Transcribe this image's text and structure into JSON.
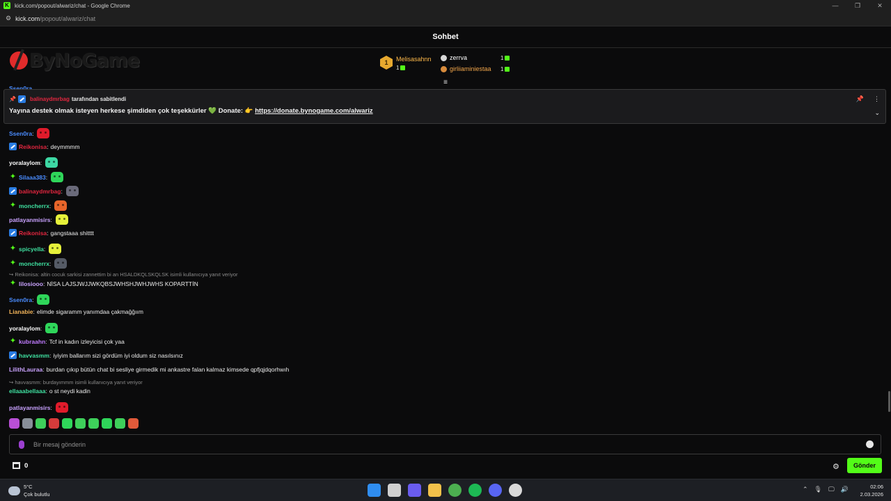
{
  "window": {
    "title": "kick.com/popout/alwariz/chat - Google Chrome",
    "controls": [
      "—",
      "❐",
      "✕"
    ],
    "url_host": "kick.com",
    "url_path": "/popout/alwariz/chat"
  },
  "chat": {
    "title": "Sohbet"
  },
  "logo": {
    "text": "ByNoGame"
  },
  "leaderboard": {
    "first": {
      "rank": "1",
      "name": "Melisasahnn",
      "count": "1"
    },
    "others": [
      {
        "name": "zerrva",
        "count": "1",
        "name_color": "#ffffff",
        "icon_color": "#d8d8d8"
      },
      {
        "name": "girliiaminiestaa",
        "count": "1",
        "name_color": "#f2a64a",
        "icon_color": "#d78b3c"
      }
    ]
  },
  "pinned": {
    "pinned_by_user": "balinaydmrbag",
    "pinned_by_label": "tarafından sabitlendi",
    "text_before": "Yayına destek olmak isteyen herkese şimdiden çok teşekkürler ",
    "heart": "💚",
    "text_mid": " Donate: ",
    "hand": "👉",
    "link": "https://donate.bynogame.com/alwariz"
  },
  "messages": [
    {
      "user": "Ssen0ra",
      "color": "#4a8cff",
      "badge": "none",
      "text": "",
      "emote": "#e01b2b"
    },
    {
      "user": "Reikonisa",
      "color": "#e3263f",
      "badge": "sub",
      "text": "deymmmm",
      "emote": ""
    },
    {
      "user": "yoralaylom",
      "color": "#ffffff",
      "badge": "none",
      "text": "",
      "emote": "#3dd8a4"
    },
    {
      "user": "Silaaa383",
      "color": "#4a8cff",
      "badge": "star",
      "text": "",
      "emote": "#2fd65a"
    },
    {
      "user": "balinaydmrbag",
      "color": "#e3263f",
      "badge": "sub",
      "text": "",
      "emote": "#6a6a7a"
    },
    {
      "user": "moncherrx",
      "color": "#3fe0a0",
      "badge": "star",
      "text": "",
      "emote": "#e8652a"
    },
    {
      "user": "patlayanmisirs",
      "color": "#c9a2ff",
      "badge": "none",
      "text": "",
      "emote": "#e6f13a"
    },
    {
      "user": "Reikonisa",
      "color": "#e3263f",
      "badge": "sub",
      "text": "gangstaaa shitttt",
      "emote": ""
    },
    {
      "user": "spicyella",
      "color": "#3fe0a0",
      "badge": "star",
      "text": "",
      "emote": "#e6f13a"
    },
    {
      "user": "moncherrx",
      "color": "#3fe0a0",
      "badge": "star",
      "text": "",
      "emote": "#555b66"
    },
    {
      "user": "lilosiooo",
      "color": "#c9a2ff",
      "badge": "star",
      "text": "NİSA LAJSJWJJWKQBSJWHSHJWHJWHS KOPARTTİN",
      "emote": ""
    },
    {
      "user": "Ssen0ra",
      "color": "#4a8cff",
      "badge": "none",
      "text": "",
      "emote": "#2fd65a"
    },
    {
      "user": "Lianabie",
      "color": "#f2b45a",
      "badge": "none",
      "text": "elimde sigaramm yanımdaa çakmağğıım",
      "emote": ""
    },
    {
      "user": "yoralaylom",
      "color": "#ffffff",
      "badge": "none",
      "text": "",
      "emote": "#2fd65a"
    },
    {
      "user": "kubraahn",
      "color": "#c07bff",
      "badge": "star",
      "text": "Tcf in kadın izleyicisi çok yaa",
      "emote": ""
    },
    {
      "user": "havvasmm",
      "color": "#3fe0a0",
      "badge": "sub",
      "text": "iyiyim ballarım sizi gördüm iyi oldum siz nasılsınız",
      "emote": ""
    },
    {
      "user": "LilithLauraa",
      "color": "#c9a2ff",
      "badge": "none",
      "text": "burdan çıkıp bütün chat bi sesliye girmedik mi ankastre falan kalmaz kimsede qpfjqjdqorhwıh",
      "emote": ""
    },
    {
      "user": "ellaaabellaaa",
      "color": "#3fe0a0",
      "badge": "none",
      "text": "o st neydi kadin",
      "emote": ""
    },
    {
      "user": "patlayanmisirs",
      "color": "#c9a2ff",
      "badge": "none",
      "text": "",
      "emote": "#e01b2b"
    }
  ],
  "replies": [
    {
      "text": "↪ Reikonisa: altin cocuk sarkisi zannettim bi an HSALDKQLSKQLSK isimli kullanıcıya yanıt veriyor"
    },
    {
      "text": "↪ havvasmm: burdayımmm isimli kullanıcıya yanıt veriyor"
    }
  ],
  "top_partial": {
    "user": "Ssen0ra"
  },
  "composer": {
    "placeholder": "Bir mesaj gönderin",
    "points": "0",
    "send_label": "Gönder"
  },
  "quick_emotes": [
    "#b94fd6",
    "#888f99",
    "#3ecf5a",
    "#d63b3b",
    "#2fd65a",
    "#3ecf5a",
    "#3ecf5a",
    "#2fd65a",
    "#3ecf5a",
    "#e05a3a"
  ],
  "taskbar": {
    "temp": "5°C",
    "weather": "Çok bulutlu",
    "time": "02:06",
    "date": "2.03.2026",
    "tray": [
      "⌃",
      "🎙",
      "🖵",
      "🔊"
    ],
    "apps": [
      "#2f8df0",
      "#d0d0d0",
      "#6a5cf0",
      "#f2c14a",
      "#4caf50",
      "#1db954",
      "#5865f2",
      "#d9d9d9"
    ]
  }
}
